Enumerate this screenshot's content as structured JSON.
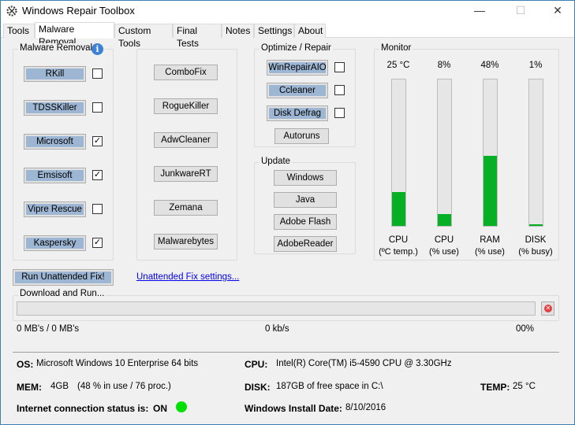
{
  "window": {
    "title": "Windows Repair Toolbox",
    "minimize": "—",
    "maximize": "☐",
    "close": "✕"
  },
  "tabs": [
    "Tools",
    "Malware Removal",
    "Custom Tools",
    "Final Tests",
    "Notes",
    "Settings",
    "About"
  ],
  "malware": {
    "title": "Malware Removal",
    "items": [
      {
        "label": "RKill",
        "checked": false
      },
      {
        "label": "TDSSKiller",
        "checked": false
      },
      {
        "label": "Microsoft",
        "checked": true
      },
      {
        "label": "Emsisoft",
        "checked": true
      },
      {
        "label": "Vipre Rescue",
        "checked": false
      },
      {
        "label": "Kaspersky",
        "checked": true
      }
    ]
  },
  "other_tools": [
    "ComboFix",
    "RogueKiller",
    "AdwCleaner",
    "JunkwareRT",
    "Zemana",
    "Malwarebytes"
  ],
  "optimize": {
    "title": "Optimize / Repair",
    "items": [
      {
        "label": "WinRepairAIO",
        "checked": false
      },
      {
        "label": "Ccleaner",
        "checked": false
      },
      {
        "label": "Disk Defrag",
        "checked": false
      }
    ],
    "autoruns": "Autoruns"
  },
  "update": {
    "title": "Update",
    "items": [
      "Windows",
      "Java",
      "Adobe Flash",
      "AdobeReader"
    ]
  },
  "monitor": {
    "title": "Monitor",
    "meters": [
      {
        "value": "25 °C",
        "fraction": 0.23,
        "label": "CPU",
        "sub": "(ºC temp.)"
      },
      {
        "value": "8%",
        "fraction": 0.08,
        "label": "CPU",
        "sub": "(% use)"
      },
      {
        "value": "48%",
        "fraction": 0.48,
        "label": "RAM",
        "sub": "(% use)"
      },
      {
        "value": "1%",
        "fraction": 0.01,
        "label": "DISK",
        "sub": "(% busy)"
      }
    ],
    "color": "#06b025"
  },
  "unattended": {
    "button": "Run Unattended Fix!",
    "link": "Unattended Fix settings..."
  },
  "download": {
    "title": "Download and Run...",
    "progress": 0,
    "size": "0 MB's / 0 MB's",
    "speed": "0 kb/s",
    "percent": "00%"
  },
  "info": {
    "os_label": "OS:",
    "os": "Microsoft Windows 10 Enterprise 64 bits",
    "cpu_label": "CPU:",
    "cpu": "Intel(R) Core(TM) i5-4590 CPU @ 3.30GHz",
    "mem_label": "MEM:",
    "mem": "4GB",
    "mem_detail": "(48 % in use / 76 proc.)",
    "disk_label": "DISK:",
    "disk": "187GB of free space in C:\\",
    "temp_label": "TEMP:",
    "temp": "25 °C",
    "net_label": "Internet connection status is:",
    "net": "ON",
    "install_label": "Windows Install Date:",
    "install": "8/10/2016"
  }
}
